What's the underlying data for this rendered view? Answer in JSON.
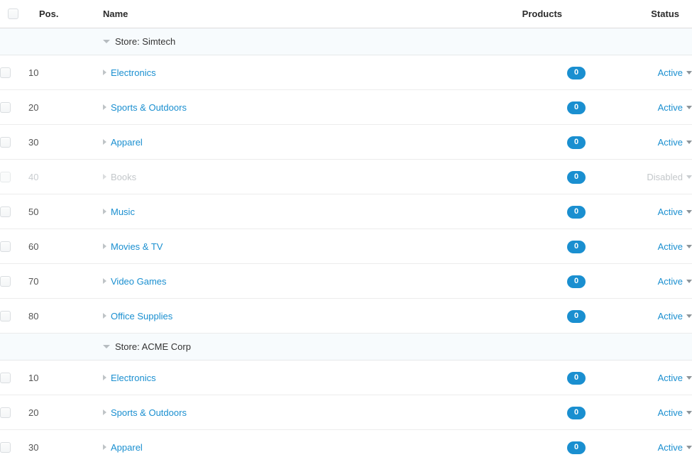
{
  "table": {
    "columns": {
      "checkbox": "",
      "position": "Pos.",
      "name": "Name",
      "products": "Products",
      "status": "Status"
    },
    "groups": [
      {
        "label": "Store: Simtech",
        "expanded": true,
        "rows": [
          {
            "position": "10",
            "name": "Electronics",
            "products": "0",
            "status": "Active",
            "disabled": false
          },
          {
            "position": "20",
            "name": "Sports & Outdoors",
            "products": "0",
            "status": "Active",
            "disabled": false
          },
          {
            "position": "30",
            "name": "Apparel",
            "products": "0",
            "status": "Active",
            "disabled": false
          },
          {
            "position": "40",
            "name": "Books",
            "products": "0",
            "status": "Disabled",
            "disabled": true
          },
          {
            "position": "50",
            "name": "Music",
            "products": "0",
            "status": "Active",
            "disabled": false
          },
          {
            "position": "60",
            "name": "Movies & TV",
            "products": "0",
            "status": "Active",
            "disabled": false
          },
          {
            "position": "70",
            "name": "Video Games",
            "products": "0",
            "status": "Active",
            "disabled": false
          },
          {
            "position": "80",
            "name": "Office Supplies",
            "products": "0",
            "status": "Active",
            "disabled": false
          }
        ]
      },
      {
        "label": "Store: ACME Corp",
        "expanded": true,
        "rows": [
          {
            "position": "10",
            "name": "Electronics",
            "products": "0",
            "status": "Active",
            "disabled": false
          },
          {
            "position": "20",
            "name": "Sports & Outdoors",
            "products": "0",
            "status": "Active",
            "disabled": false
          },
          {
            "position": "30",
            "name": "Apparel",
            "products": "0",
            "status": "Active",
            "disabled": false
          }
        ]
      }
    ]
  },
  "colors": {
    "link": "#1a8fd0",
    "badge_bg": "#1a8fd0",
    "group_row_bg": "#f7fbfd",
    "row_border": "#ececec",
    "header_text": "#2b2b2b",
    "disabled_text": "#c3c7ca"
  }
}
